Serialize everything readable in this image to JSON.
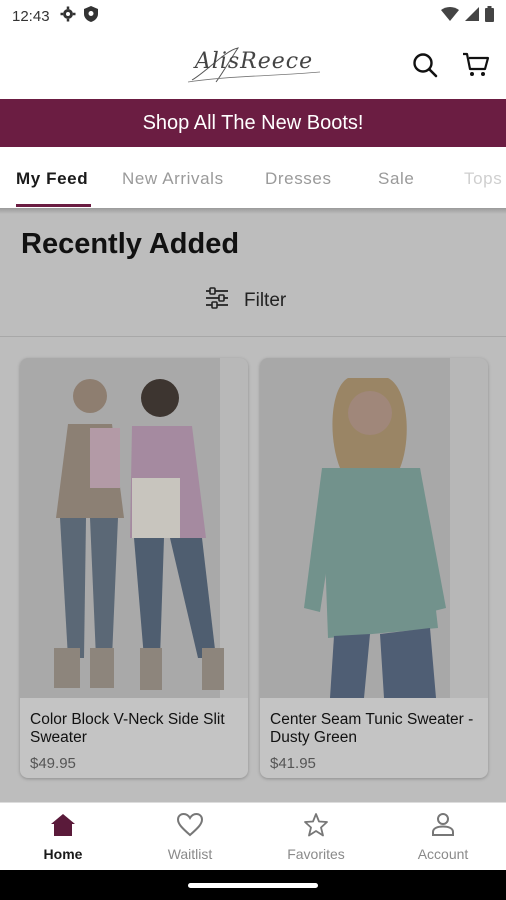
{
  "status": {
    "time": "12:43"
  },
  "header": {
    "logo_text": "AlisReece"
  },
  "promo": {
    "text": "Shop All The New Boots!"
  },
  "tabs": [
    {
      "label": "My Feed"
    },
    {
      "label": "New Arrivals"
    },
    {
      "label": "Dresses"
    },
    {
      "label": "Sale"
    },
    {
      "label": "Tops"
    }
  ],
  "feed": {
    "title": "Recently Added",
    "filter_label": "Filter",
    "products": [
      {
        "name": "Color Block V-Neck Side Slit Sweater",
        "price": "$49.95"
      },
      {
        "name": "Center Seam Tunic Sweater - Dusty Green",
        "price": "$41.95"
      }
    ]
  },
  "bottom_nav": [
    {
      "label": "Home",
      "icon": "home-icon"
    },
    {
      "label": "Waitlist",
      "icon": "heart-icon"
    },
    {
      "label": "Favorites",
      "icon": "star-icon"
    },
    {
      "label": "Account",
      "icon": "person-icon"
    }
  ],
  "colors": {
    "brand": "#6b1d42"
  }
}
